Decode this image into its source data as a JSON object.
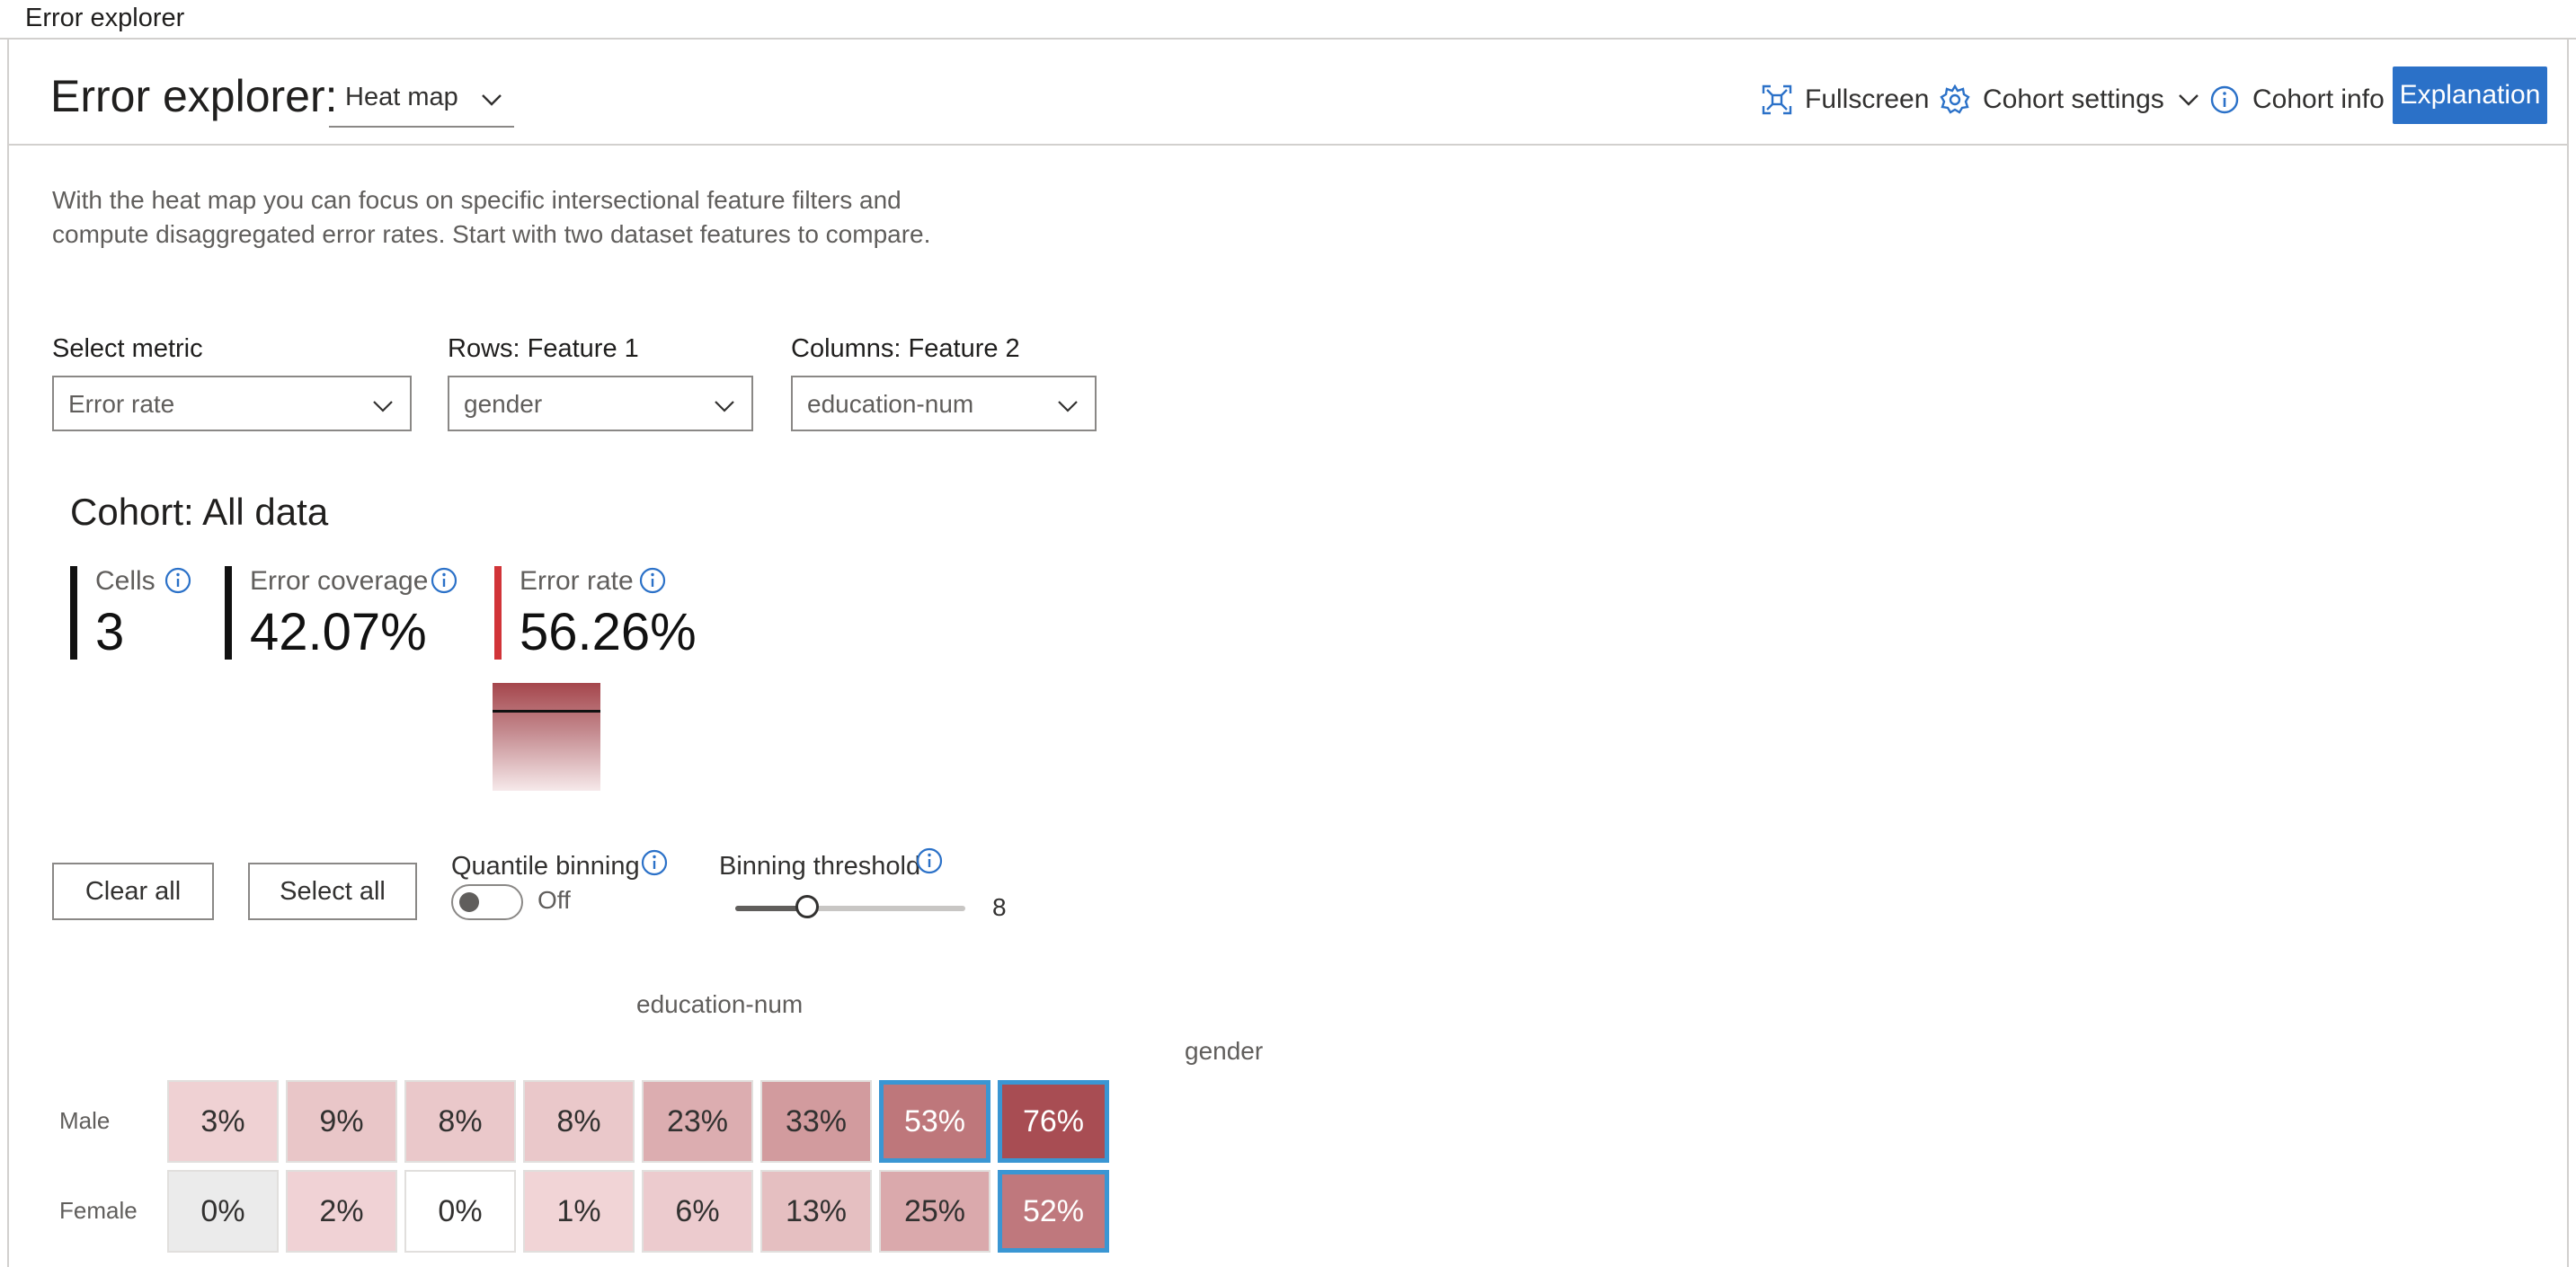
{
  "window": {
    "title": "Error explorer"
  },
  "header": {
    "title": "Error explorer:",
    "view_selector": "Heat map",
    "fullscreen": "Fullscreen",
    "cohort_settings": "Cohort settings",
    "cohort_info": "Cohort info",
    "explanation": "Explanation"
  },
  "description": {
    "line1": "With the heat map you can focus on specific intersectional feature filters and",
    "line2": "compute disaggregated error rates. Start with two dataset features to compare."
  },
  "controls": {
    "metric": {
      "label": "Select metric",
      "value": "Error rate"
    },
    "rows": {
      "label": "Rows: Feature 1",
      "value": "gender"
    },
    "columns": {
      "label": "Columns: Feature 2",
      "value": "education-num"
    }
  },
  "cohort": {
    "title": "Cohort: All data",
    "cells": {
      "label": "Cells",
      "value": "3"
    },
    "error_coverage": {
      "label": "Error coverage",
      "value": "42.07%"
    },
    "error_rate": {
      "label": "Error rate",
      "value": "56.26%"
    }
  },
  "buttons": {
    "clear_all": "Clear all",
    "select_all": "Select all"
  },
  "quantile_binning": {
    "label": "Quantile binning",
    "state": "Off",
    "enabled": false
  },
  "binning_threshold": {
    "label": "Binning threshold",
    "value": "8",
    "min": 2,
    "max": 20
  },
  "heatmap": {
    "column_feature": "education-num",
    "row_feature": "gender",
    "rows": [
      {
        "label": "Male",
        "cells": [
          {
            "text": "3%",
            "value": 3,
            "selected": false
          },
          {
            "text": "9%",
            "value": 9,
            "selected": false
          },
          {
            "text": "8%",
            "value": 8,
            "selected": false
          },
          {
            "text": "8%",
            "value": 8,
            "selected": false
          },
          {
            "text": "23%",
            "value": 23,
            "selected": false
          },
          {
            "text": "33%",
            "value": 33,
            "selected": false
          },
          {
            "text": "53%",
            "value": 53,
            "selected": true
          },
          {
            "text": "76%",
            "value": 76,
            "selected": true
          }
        ]
      },
      {
        "label": "Female",
        "cells": [
          {
            "text": "0%",
            "value": 0,
            "selected": false,
            "bg": "#ebebeb"
          },
          {
            "text": "2%",
            "value": 2,
            "selected": false
          },
          {
            "text": "0%",
            "value": 0,
            "selected": false,
            "bg": "#ffffff"
          },
          {
            "text": "1%",
            "value": 1,
            "selected": false
          },
          {
            "text": "6%",
            "value": 6,
            "selected": false
          },
          {
            "text": "13%",
            "value": 13,
            "selected": false
          },
          {
            "text": "25%",
            "value": 25,
            "selected": false
          },
          {
            "text": "52%",
            "value": 52,
            "selected": true
          }
        ]
      }
    ]
  },
  "colors": {
    "accent": "#2b71c8",
    "error_bar": "#d13438",
    "selection": "#3a96d3"
  },
  "icons": {
    "fullscreen": "fullscreen-icon",
    "cohort_settings": "gear-icon",
    "cohort_info": "info-icon"
  }
}
